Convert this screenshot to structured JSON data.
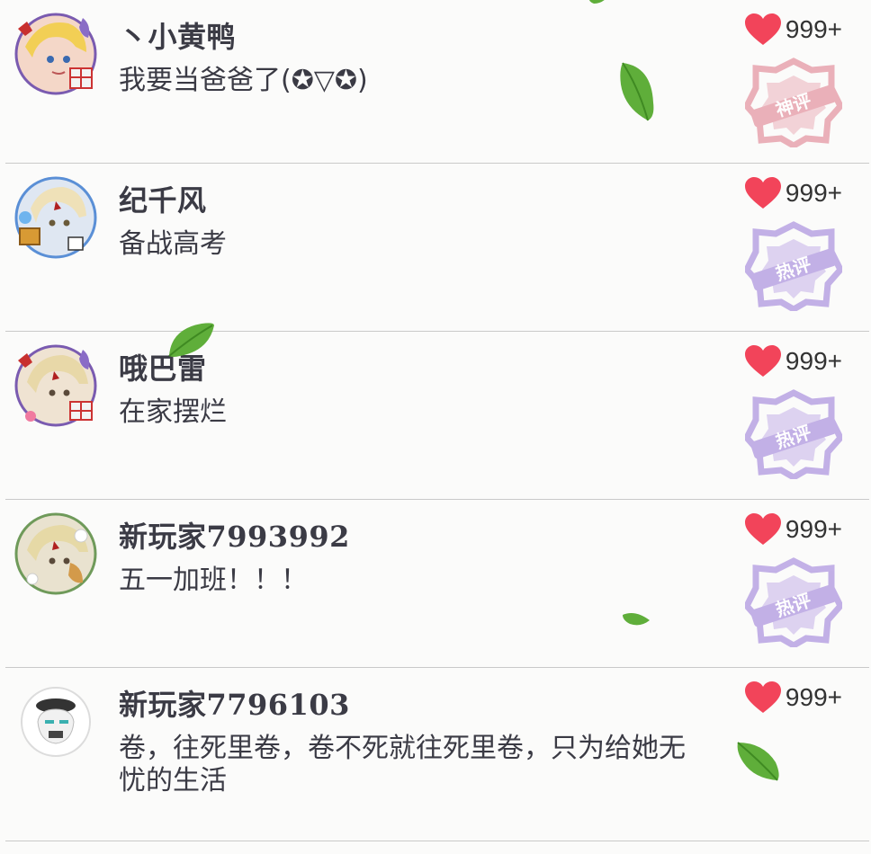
{
  "comments": [
    {
      "username": "丶小黄鸭",
      "content": "我要当爸爸了(✪▽✪)",
      "likes": "999+",
      "badge": {
        "label": "神评",
        "color": "#e8a4ae"
      }
    },
    {
      "username": "纪千风",
      "content": "备战高考",
      "likes": "999+",
      "badge": {
        "label": "热评",
        "color": "#b9a3e3"
      }
    },
    {
      "username": "哦巴雷",
      "content": "在家摆烂",
      "likes": "999+",
      "badge": {
        "label": "热评",
        "color": "#b9a3e3"
      }
    },
    {
      "username": "新玩家7993992",
      "content": "五一加班！！！",
      "likes": "999+",
      "badge": {
        "label": "热评",
        "color": "#b9a3e3"
      }
    },
    {
      "username": "新玩家7796103",
      "content": "卷，往死里卷，卷不死就往死里卷，只为给她无忧的生活",
      "likes": "999+",
      "badge": null
    }
  ],
  "colors": {
    "heart": "#f2445a",
    "leaf": "#5fae3a",
    "divider": "#c9c9c9"
  },
  "icons": [
    "heart-icon",
    "leaf-decoration",
    "badge-stamp"
  ]
}
